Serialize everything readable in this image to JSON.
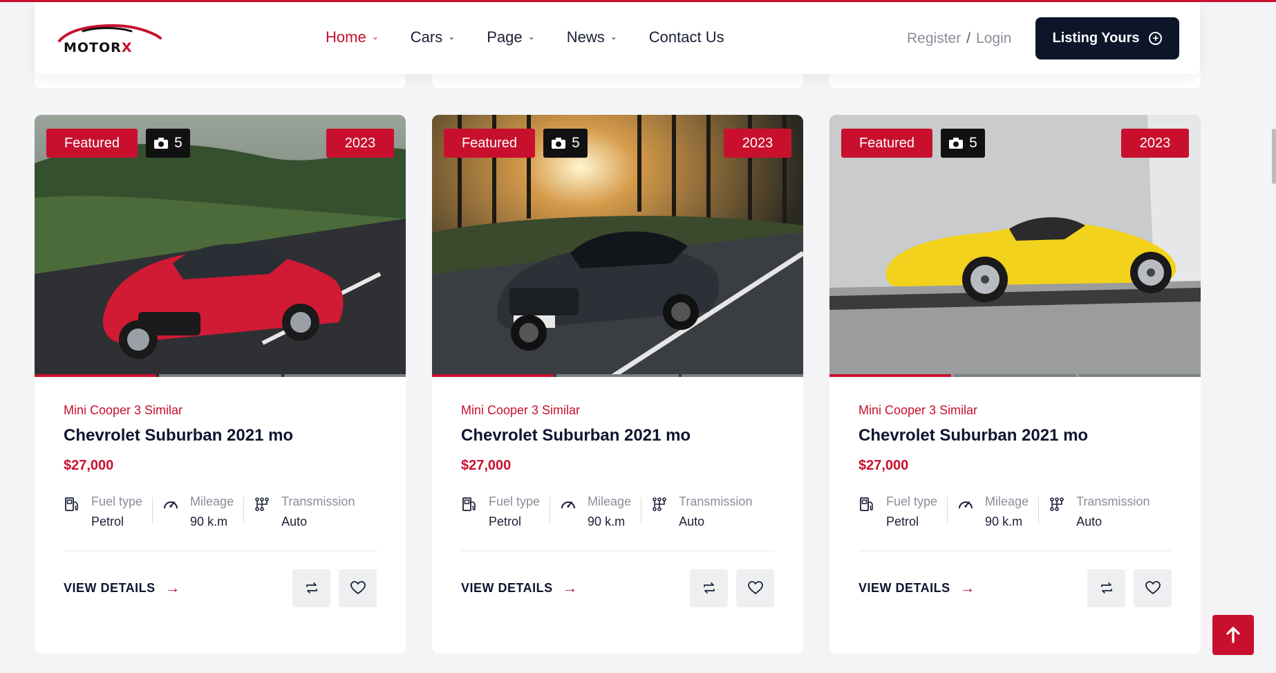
{
  "header": {
    "logo_text": "MOTORX",
    "nav": [
      {
        "label": "Home",
        "has_dropdown": true,
        "active": true
      },
      {
        "label": "Cars",
        "has_dropdown": true,
        "active": false
      },
      {
        "label": "Page",
        "has_dropdown": true,
        "active": false
      },
      {
        "label": "News",
        "has_dropdown": true,
        "active": false
      },
      {
        "label": "Contact Us",
        "has_dropdown": false,
        "active": false
      }
    ],
    "register_label": "Register",
    "auth_separator": "/",
    "login_label": "Login",
    "listing_button_label": "Listing Yours"
  },
  "cards": [
    {
      "featured_label": "Featured",
      "photo_count": "5",
      "year": "2023",
      "image_subject": "red sports coupe on road",
      "subtitle": "Mini Cooper 3 Similar",
      "title": "Chevrolet Suburban 2021 mo",
      "price": "$27,000",
      "specs": [
        {
          "icon": "fuel-icon",
          "label": "Fuel type",
          "value": "Petrol"
        },
        {
          "icon": "speedometer-icon",
          "label": "Mileage",
          "value": "90 k.m"
        },
        {
          "icon": "gearbox-icon",
          "label": "Transmission",
          "value": "Auto"
        }
      ],
      "view_details_label": "VIEW DETAILS",
      "active_slide": 1,
      "slides": 3
    },
    {
      "featured_label": "Featured",
      "photo_count": "5",
      "year": "2023",
      "image_subject": "dark grey sedan driving through forest at sunset",
      "subtitle": "Mini Cooper 3 Similar",
      "title": "Chevrolet Suburban 2021 mo",
      "price": "$27,000",
      "specs": [
        {
          "icon": "fuel-icon",
          "label": "Fuel type",
          "value": "Petrol"
        },
        {
          "icon": "speedometer-icon",
          "label": "Mileage",
          "value": "90 k.m"
        },
        {
          "icon": "gearbox-icon",
          "label": "Transmission",
          "value": "Auto"
        }
      ],
      "view_details_label": "VIEW DETAILS",
      "active_slide": 1,
      "slides": 3
    },
    {
      "featured_label": "Featured",
      "photo_count": "5",
      "year": "2023",
      "image_subject": "yellow supercar parked against grey wall",
      "subtitle": "Mini Cooper 3 Similar",
      "title": "Chevrolet Suburban 2021 mo",
      "price": "$27,000",
      "specs": [
        {
          "icon": "fuel-icon",
          "label": "Fuel type",
          "value": "Petrol"
        },
        {
          "icon": "speedometer-icon",
          "label": "Mileage",
          "value": "90 k.m"
        },
        {
          "icon": "gearbox-icon",
          "label": "Transmission",
          "value": "Auto"
        }
      ],
      "view_details_label": "VIEW DETAILS",
      "active_slide": 1,
      "slides": 3
    }
  ],
  "colors": {
    "accent": "#c8102e",
    "dark": "#0d1529",
    "muted": "#8a8d99"
  },
  "scroll_top_icon": "arrow-up-icon"
}
